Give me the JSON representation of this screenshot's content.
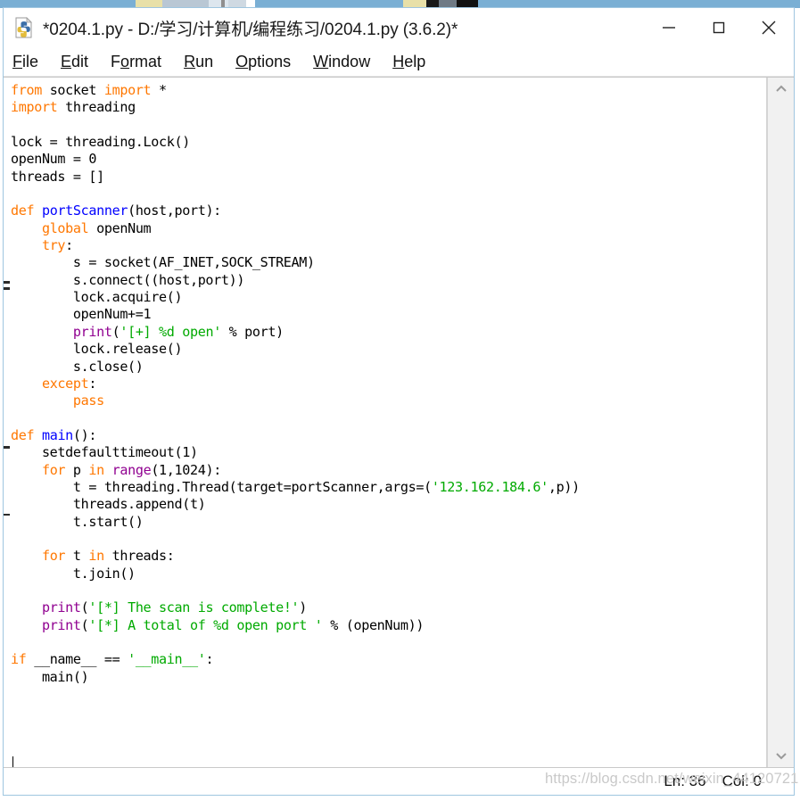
{
  "window": {
    "title": "*0204.1.py - D:/学习/计算机/编程练习/0204.1.py (3.6.2)*",
    "app_icon": "python-file-icon",
    "controls": {
      "minimize": "minimize-icon",
      "maximize": "maximize-icon",
      "close": "close-icon"
    }
  },
  "menu": {
    "items": [
      {
        "label": "File",
        "mnemonic": "F",
        "rest": "ile"
      },
      {
        "label": "Edit",
        "mnemonic": "E",
        "rest": "dit",
        "pre": ""
      },
      {
        "label": "Format",
        "mnemonic": "o",
        "pre": "F",
        "rest": "rmat"
      },
      {
        "label": "Run",
        "mnemonic": "R",
        "pre": "",
        "rest": "un"
      },
      {
        "label": "Options",
        "mnemonic": "O",
        "pre": "",
        "rest": "ptions"
      },
      {
        "label": "Window",
        "mnemonic": "W",
        "pre": "",
        "rest": "indow"
      },
      {
        "label": "Help",
        "mnemonic": "H",
        "pre": "",
        "rest": "elp"
      }
    ]
  },
  "editor": {
    "language": "python",
    "code_lines": [
      "from socket import *",
      "import threading",
      "",
      "lock = threading.Lock()",
      "openNum = 0",
      "threads = []",
      "",
      "def portScanner(host,port):",
      "    global openNum",
      "    try:",
      "        s = socket(AF_INET,SOCK_STREAM)",
      "        s.connect((host,port))",
      "        lock.acquire()",
      "        openNum+=1",
      "        print('[+] %d open' % port)",
      "        lock.release()",
      "        s.close()",
      "    except:",
      "        pass",
      "",
      "def main():",
      "    setdefaulttimeout(1)",
      "    for p in range(1,1024):",
      "        t = threading.Thread(target=portScanner,args=('123.162.184.6',p))",
      "        threads.append(t)",
      "        t.start()",
      "",
      "    for t in threads:",
      "        t.join()",
      "",
      "    print('[*] The scan is complete!')",
      "    print('[*] A total of %d open port ' % (openNum))",
      "",
      "if __name__ == '__main__':",
      "    main()",
      ""
    ],
    "syntax_colors": {
      "keyword": "#ff7700",
      "definition": "#0000ff",
      "builtin": "#900090",
      "string": "#00aa00",
      "text": "#000000"
    },
    "scrollbar": {
      "up_arrow": "chevron-up-icon",
      "down_arrow": "chevron-down-icon"
    }
  },
  "status_bar": {
    "line_label": "Ln: 36",
    "col_label": "Col: 0"
  },
  "watermark": {
    "text": "https://blog.csdn.net/weixin_44120721"
  }
}
